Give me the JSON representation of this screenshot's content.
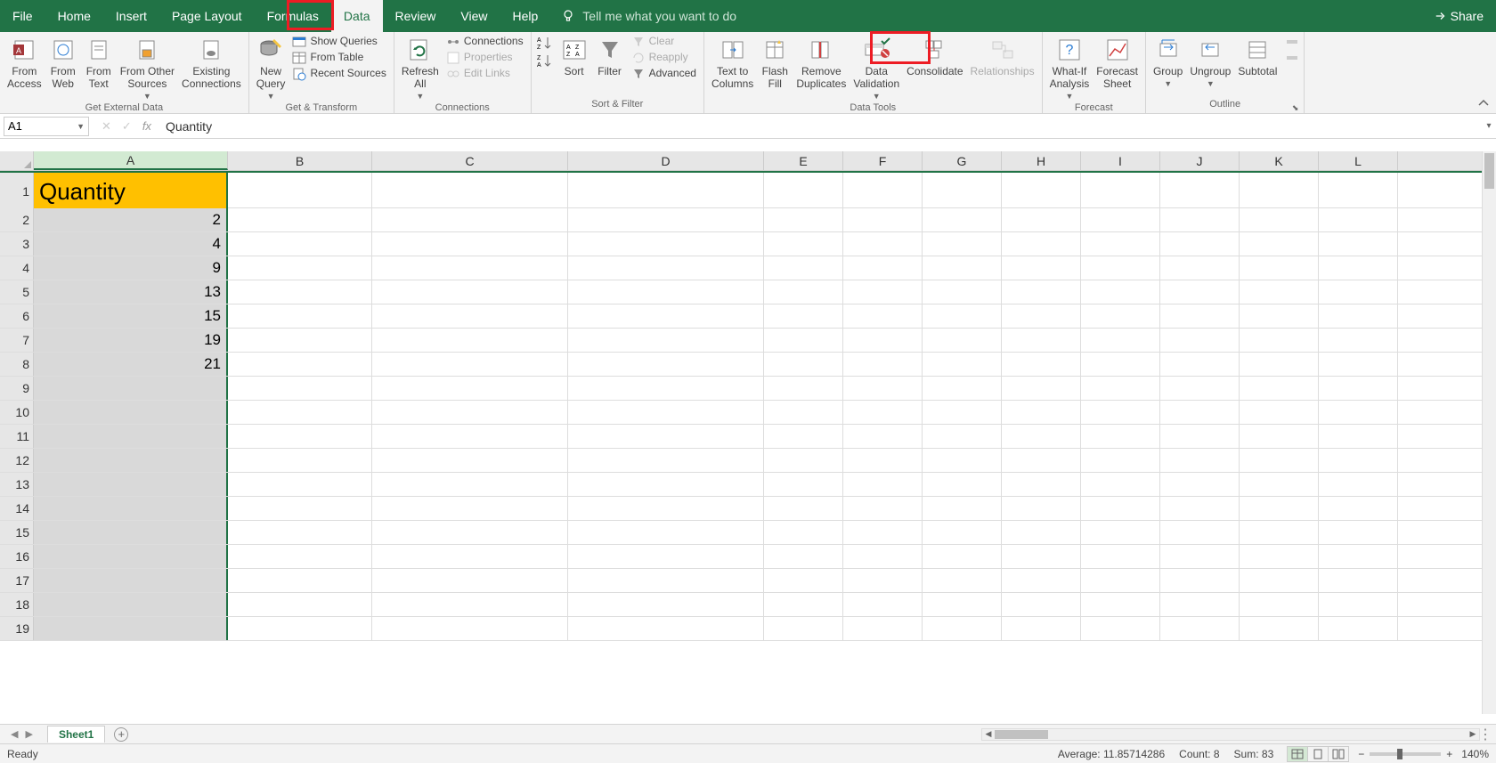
{
  "menu": {
    "tabs": [
      "File",
      "Home",
      "Insert",
      "Page Layout",
      "Formulas",
      "Data",
      "Review",
      "View",
      "Help"
    ],
    "active": "Data",
    "tell_me": "Tell me what you want to do",
    "share": "Share"
  },
  "ribbon": {
    "get_external": {
      "from_access": "From\nAccess",
      "from_web": "From\nWeb",
      "from_text": "From\nText",
      "from_other_sources": "From Other\nSources",
      "existing_connections": "Existing\nConnections",
      "group_label": "Get External Data"
    },
    "get_transform": {
      "new_query": "New\nQuery",
      "show_queries": "Show Queries",
      "from_table": "From Table",
      "recent_sources": "Recent Sources",
      "group_label": "Get & Transform"
    },
    "connections": {
      "refresh_all": "Refresh\nAll",
      "connections": "Connections",
      "properties": "Properties",
      "edit_links": "Edit Links",
      "group_label": "Connections"
    },
    "sort_filter": {
      "sort_az": "A→Z",
      "sort_za": "Z→A",
      "sort": "Sort",
      "filter": "Filter",
      "clear": "Clear",
      "reapply": "Reapply",
      "advanced": "Advanced",
      "group_label": "Sort & Filter"
    },
    "data_tools": {
      "text_to_columns": "Text to\nColumns",
      "flash_fill": "Flash\nFill",
      "remove_duplicates": "Remove\nDuplicates",
      "data_validation": "Data\nValidation",
      "consolidate": "Consolidate",
      "relationships": "Relationships",
      "group_label": "Data Tools"
    },
    "forecast": {
      "whatif": "What-If\nAnalysis",
      "forecast_sheet": "Forecast\nSheet",
      "group_label": "Forecast"
    },
    "outline": {
      "group": "Group",
      "ungroup": "Ungroup",
      "subtotal": "Subtotal",
      "group_label": "Outline"
    }
  },
  "namebox": {
    "value": "A1"
  },
  "formula": {
    "value": "Quantity"
  },
  "columns": [
    "A",
    "B",
    "C",
    "D",
    "E",
    "F",
    "G",
    "H",
    "I",
    "J",
    "K",
    "L"
  ],
  "col_widths": {
    "A": 218,
    "B": 162,
    "C": 220,
    "D": 220,
    "E": 89,
    "F": 89,
    "G": 89,
    "H": 89,
    "I": 89,
    "J": 89,
    "K": 89,
    "L": 89
  },
  "col_a_values": {
    "1": "Quantity",
    "2": "2",
    "3": "4",
    "4": "9",
    "5": "13",
    "6": "15",
    "7": "19",
    "8": "21"
  },
  "row_count": 19,
  "sheets": {
    "active": "Sheet1"
  },
  "status": {
    "ready": "Ready",
    "average_label": "Average:",
    "average_value": "11.85714286",
    "count_label": "Count:",
    "count_value": "8",
    "sum_label": "Sum:",
    "sum_value": "83",
    "zoom": "140%"
  }
}
